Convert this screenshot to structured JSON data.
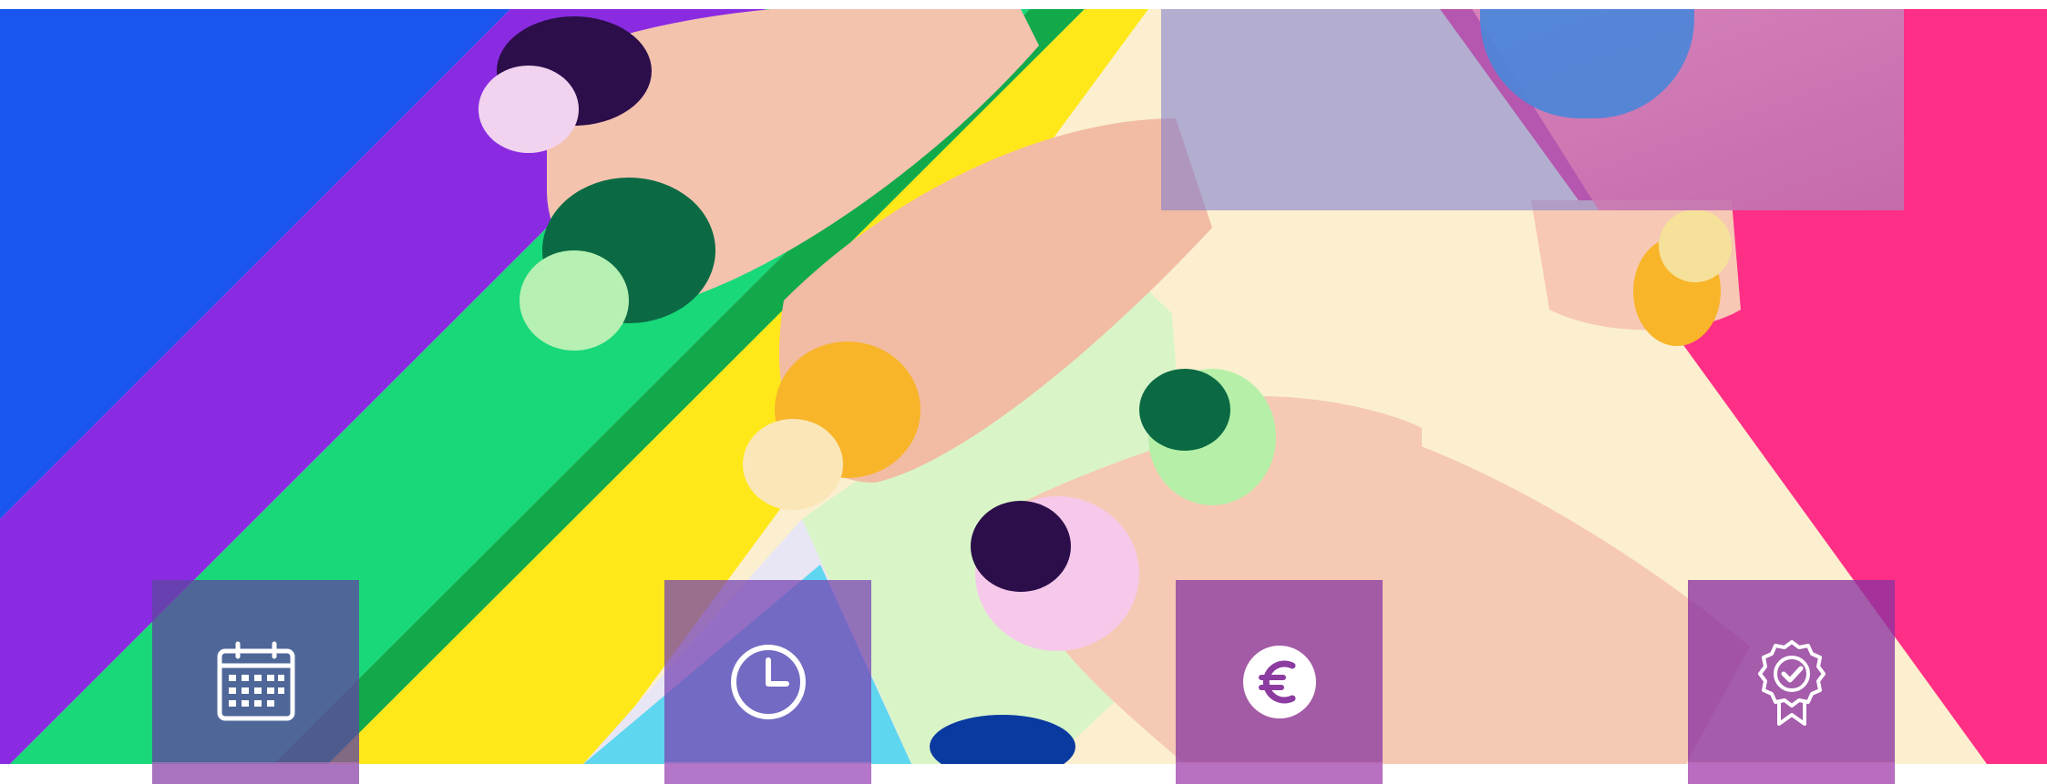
{
  "hero": {
    "image_description_icon": "nail-art-hero-image",
    "colors": {
      "blue": "#1a55f0",
      "purple": "#8a2be2",
      "green": "#18d87a",
      "yellow": "#ffe81a",
      "cream": "#fbefcf",
      "pink": "#ff2e86",
      "skin": "#f4c3ae"
    }
  },
  "features": [
    {
      "icon": "calendar-icon"
    },
    {
      "icon": "clock-icon"
    },
    {
      "icon": "euro-icon"
    },
    {
      "icon": "award-badge-icon"
    }
  ]
}
